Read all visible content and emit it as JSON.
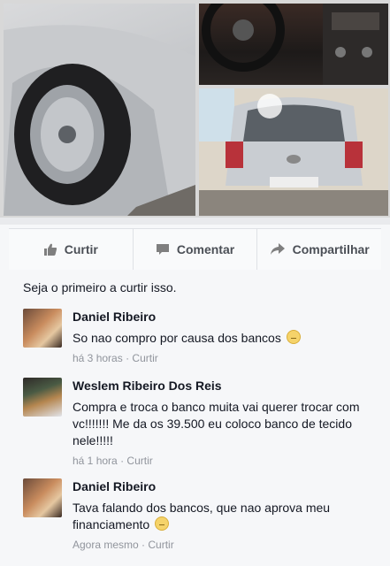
{
  "actions": {
    "like": "Curtir",
    "comment": "Comentar",
    "share": "Compartilhar"
  },
  "likes_summary": "Seja o primeiro a curtir isso.",
  "comments": [
    {
      "author": "Daniel Ribeiro",
      "text": "So nao compro por causa dos bancos",
      "emoji": "smile",
      "time": "há 3 horas",
      "like_label": "Curtir"
    },
    {
      "author": "Weslem Ribeiro Dos Reis",
      "text": "Compra e troca o banco muita vai querer trocar com vc!!!!!!! Me da os 39.500 eu coloco banco de tecido nele!!!!!",
      "time": "há 1 hora",
      "like_label": "Curtir"
    },
    {
      "author": "Daniel Ribeiro",
      "text": "Tava falando dos bancos, que nao aprova meu financiamento",
      "emoji": "disappointed",
      "time": "Agora mesmo",
      "like_label": "Curtir"
    }
  ],
  "meta_separator": "·",
  "colors": {
    "text": "#141823",
    "meta": "#90949c",
    "action": "#4b4f56"
  }
}
